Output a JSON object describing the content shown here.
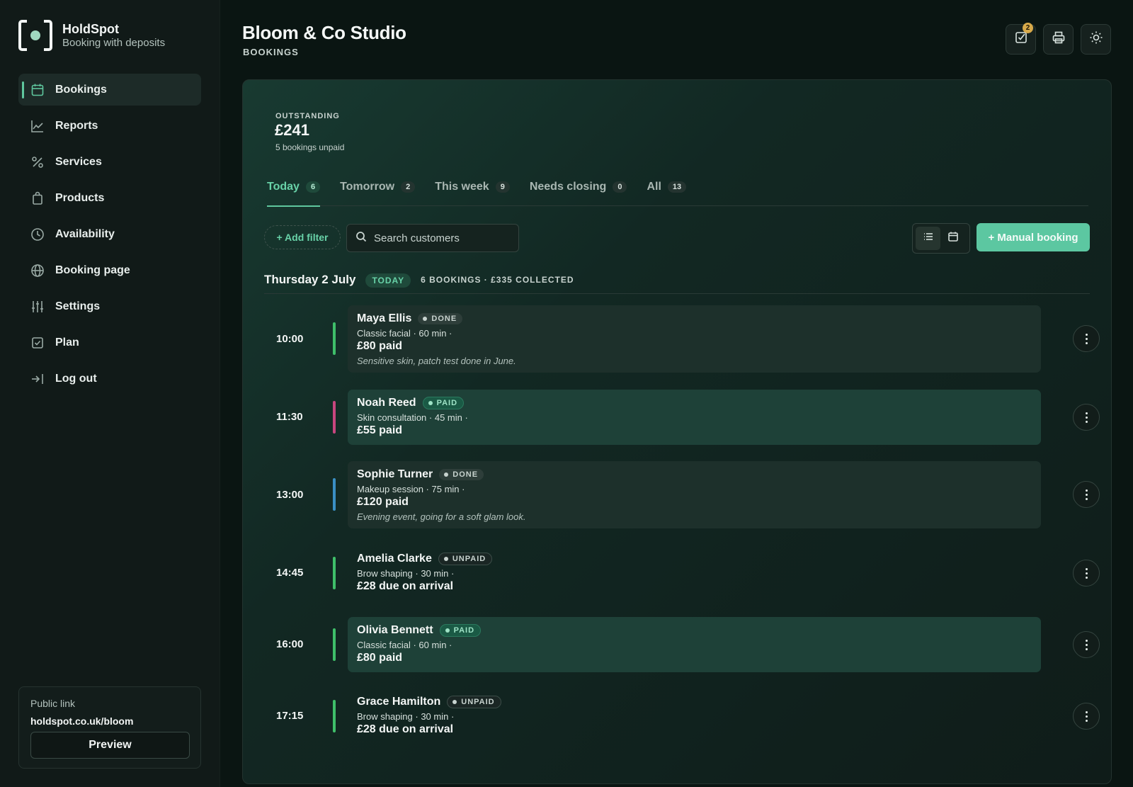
{
  "brand": {
    "name": "HoldSpot",
    "tagline": "Booking with deposits"
  },
  "sidebar": {
    "items": [
      {
        "label": "Bookings",
        "icon": "calendar-icon",
        "active": true
      },
      {
        "label": "Reports",
        "icon": "line-chart-icon"
      },
      {
        "label": "Services",
        "icon": "percent-icon"
      },
      {
        "label": "Products",
        "icon": "bag-icon"
      },
      {
        "label": "Availability",
        "icon": "clock-icon"
      },
      {
        "label": "Booking page",
        "icon": "globe-icon"
      },
      {
        "label": "Settings",
        "icon": "sliders-icon"
      },
      {
        "label": "Plan",
        "icon": "checkbox-icon"
      },
      {
        "label": "Log out",
        "icon": "logout-icon"
      }
    ],
    "public_link": {
      "label": "Public link",
      "url": "holdspot.co.uk/bloom",
      "preview_label": "Preview"
    }
  },
  "header": {
    "title": "Bloom & Co Studio",
    "subtitle": "BOOKINGS",
    "tasks_badge": "2",
    "icons": [
      "tasks-icon",
      "print-icon",
      "sun-icon"
    ]
  },
  "summary": {
    "label": "OUTSTANDING",
    "amount": "£241",
    "sub": "5 bookings unpaid"
  },
  "tabs": [
    {
      "label": "Today",
      "count": "6",
      "active": true
    },
    {
      "label": "Tomorrow",
      "count": "2"
    },
    {
      "label": "This week",
      "count": "9"
    },
    {
      "label": "Needs closing",
      "count": "0"
    },
    {
      "label": "All",
      "count": "13"
    }
  ],
  "toolbar": {
    "add_filter": "+ Add filter",
    "search_placeholder": "Search customers",
    "manual_booking": "+ Manual booking"
  },
  "day": {
    "title": "Thursday 2 July",
    "pill": "TODAY",
    "summary": "6 BOOKINGS · £335 COLLECTED"
  },
  "bookings": [
    {
      "time": "10:00",
      "name": "Maya Ellis",
      "status": "DONE",
      "detail": "Classic facial · 60 min ·",
      "amount": "£80 paid",
      "note": "Sensitive skin, patch test done in June.",
      "bar_color": "#3fbf6a"
    },
    {
      "time": "11:30",
      "name": "Noah Reed",
      "status": "PAID",
      "detail": "Skin consultation · 45 min ·",
      "amount": "£55 paid",
      "note": "",
      "bar_color": "#c8467f"
    },
    {
      "time": "13:00",
      "name": "Sophie Turner",
      "status": "DONE",
      "detail": "Makeup session · 75 min ·",
      "amount": "£120 paid",
      "note": "Evening event, going for a soft glam look.",
      "bar_color": "#3a8fc4"
    },
    {
      "time": "14:45",
      "name": "Amelia Clarke",
      "status": "UNPAID",
      "detail": "Brow shaping · 30 min ·",
      "amount": "£28 due on arrival",
      "note": "",
      "bar_color": "#3fbf6a"
    },
    {
      "time": "16:00",
      "name": "Olivia Bennett",
      "status": "PAID",
      "detail": "Classic facial · 60 min ·",
      "amount": "£80 paid",
      "note": "",
      "bar_color": "#3fbf6a"
    },
    {
      "time": "17:15",
      "name": "Grace Hamilton",
      "status": "UNPAID",
      "detail": "Brow shaping · 30 min ·",
      "amount": "£28 due on arrival",
      "note": "",
      "bar_color": "#3fbf6a"
    }
  ]
}
